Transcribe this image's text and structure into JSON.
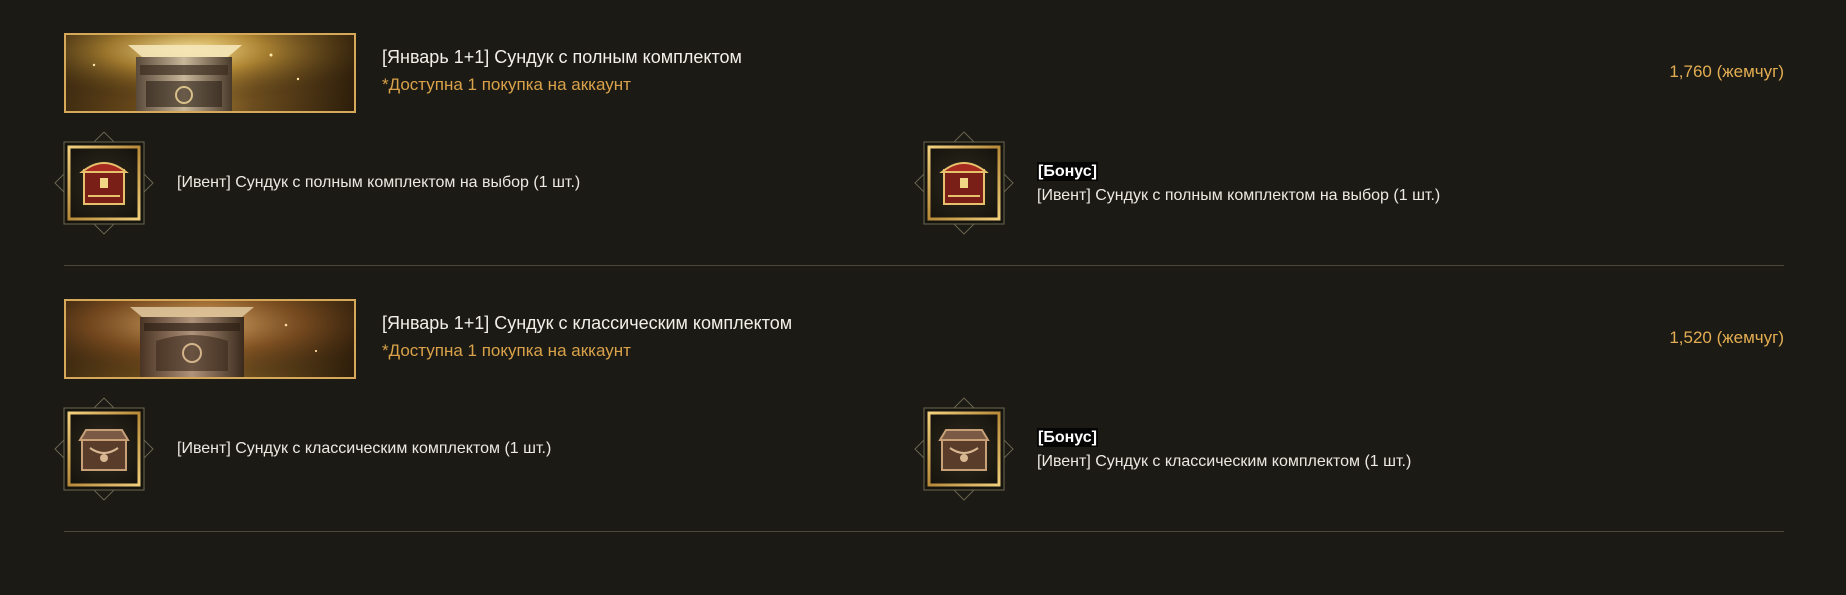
{
  "packages": [
    {
      "title": "[Январь 1+1] Сундук с полным комплектом",
      "limit": "*Доступна 1 покупка на аккаунт",
      "price": "1,760 (жемчуг)",
      "item": {
        "label": "[Ивент] Сундук с полным комплектом на выбор (1 шт.)",
        "icon": "red-ornate-chest-icon"
      },
      "bonus_item": {
        "tag": "[Бонус]",
        "label": "[Ивент] Сундук с полным комплектом на выбор (1 шт.)",
        "icon": "red-ornate-chest-icon"
      }
    },
    {
      "title": "[Январь 1+1] Сундук с классическим комплектом",
      "limit": "*Доступна 1 покупка на аккаунт",
      "price": "1,520 (жемчуг)",
      "item": {
        "label": "[Ивент] Сундук с классическим комплектом (1 шт.)",
        "icon": "bronze-chest-icon"
      },
      "bonus_item": {
        "tag": "[Бонус]",
        "label": "[Ивент] Сундук с классическим комплектом (1 шт.)",
        "icon": "bronze-chest-icon"
      }
    }
  ],
  "colors": {
    "background": "#1b1a14",
    "accent_gold": "#d9a24a",
    "price": "#e3ad52",
    "banner_border": "#d6a95a"
  }
}
